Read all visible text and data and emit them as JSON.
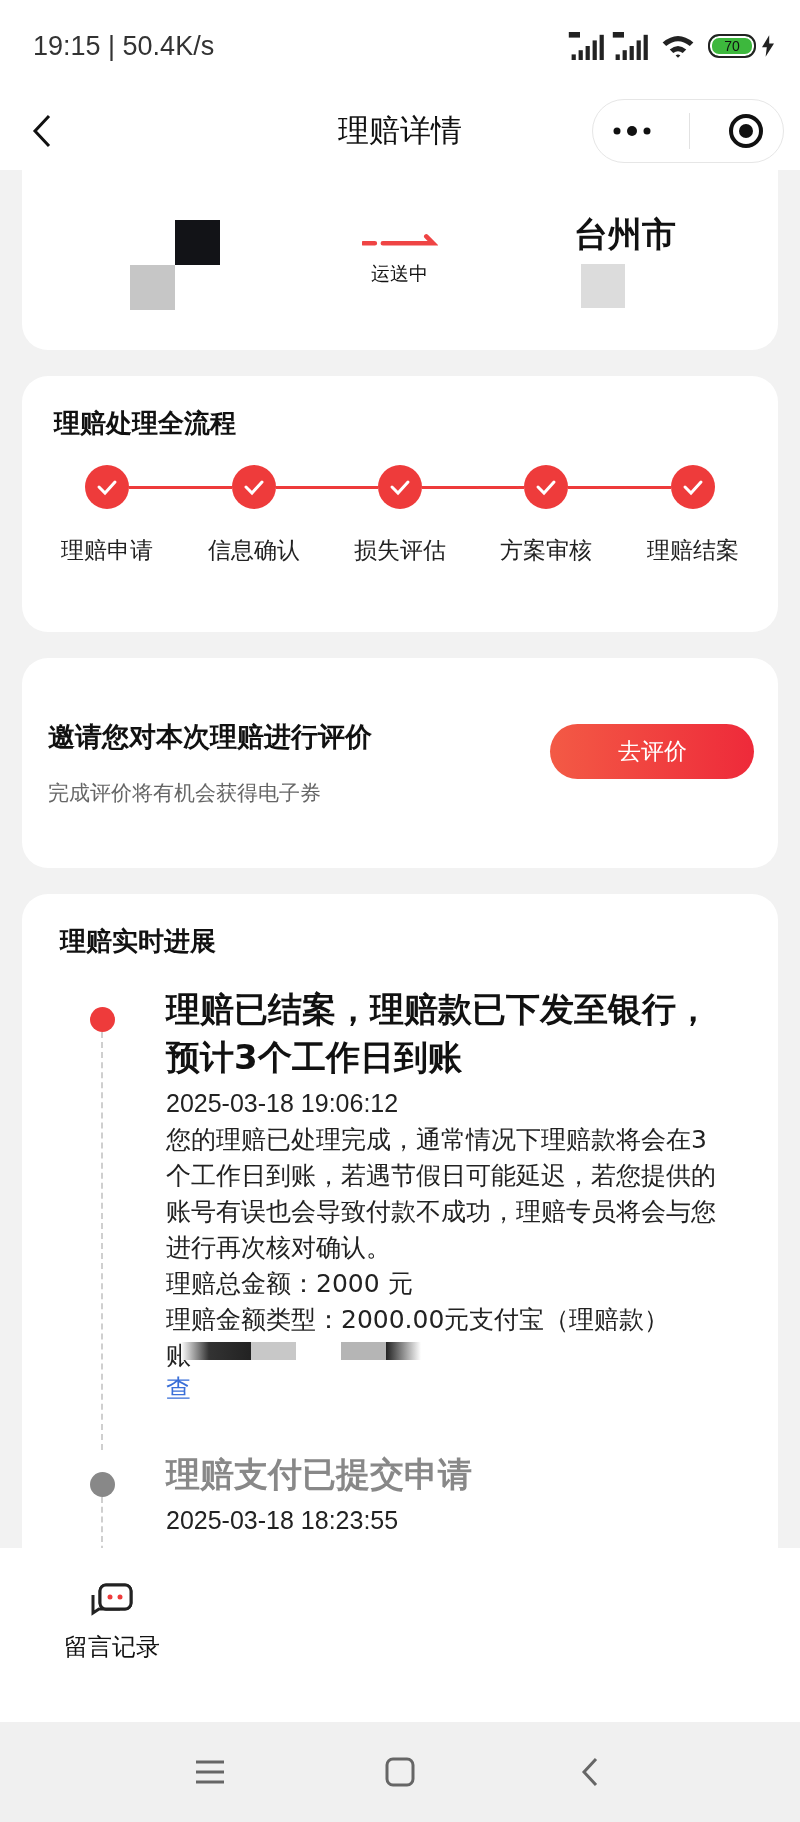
{
  "status_bar": {
    "time": "19:15 | 50.4K/s",
    "battery": "70"
  },
  "header": {
    "title": "理赔详情"
  },
  "route": {
    "destination": "台州市",
    "state": "运送中"
  },
  "process": {
    "title": "理赔处理全流程",
    "steps": [
      {
        "label": "理赔申请",
        "completed": true
      },
      {
        "label": "信息确认",
        "completed": true
      },
      {
        "label": "损失评估",
        "completed": true
      },
      {
        "label": "方案审核",
        "completed": true
      },
      {
        "label": "理赔结案",
        "completed": true
      }
    ]
  },
  "review": {
    "title": "邀请您对本次理赔进行评价",
    "subtitle": "完成评价将有机会获得电子券",
    "button": "去评价"
  },
  "progress": {
    "title": "理赔实时进展",
    "events": [
      {
        "active": true,
        "title": "理赔已结案，理赔款已下发至银行，预计3个工作日到账",
        "time": "2025-03-18 19:06:12",
        "body": "您的理赔已处理完成，通常情况下理赔款将会在3个工作日到账，若遇节假日可能延迟，若您提供的账号有误也会导致付款不成功，理赔专员将会与您进行再次核对确认。",
        "lines": [
          "理赔总金额：2000 元",
          "理赔金额类型：2000.00元支付宝（理赔款）"
        ],
        "account": "账",
        "link": "查"
      },
      {
        "active": false,
        "title": "理赔支付已提交申请",
        "time": "2025-03-18 18:23:55"
      }
    ]
  },
  "bottom": {
    "label": "留言记录"
  }
}
